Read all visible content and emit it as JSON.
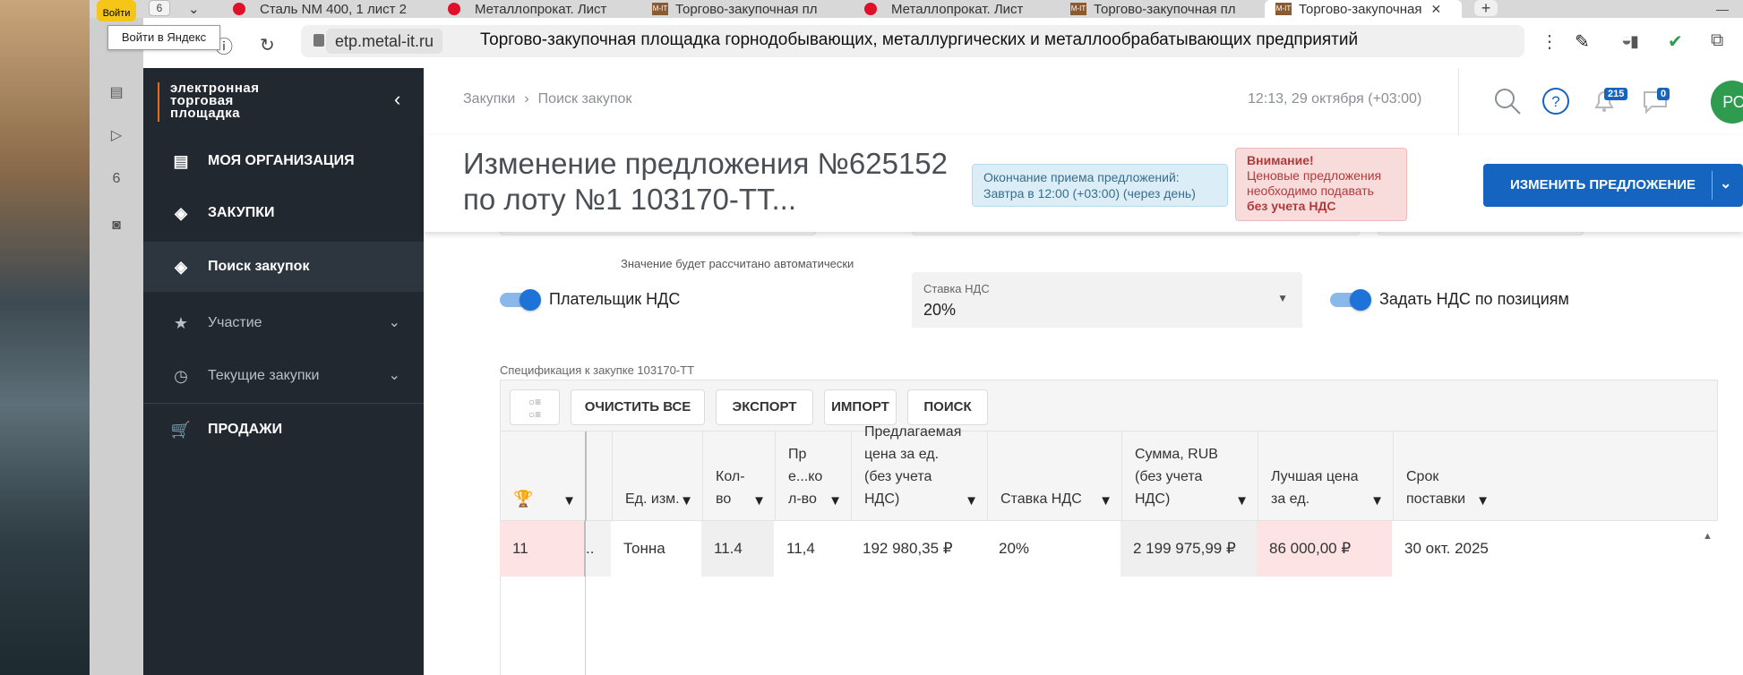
{
  "browser": {
    "tab_count": "6",
    "tabs": [
      {
        "title": "Сталь NM 400, 1 лист 2",
        "favicon": "red-dot"
      },
      {
        "title": "Металлопрокат. Лист",
        "favicon": "red-dot"
      },
      {
        "title": "Торгово-закупочная пл",
        "favicon": "mit"
      },
      {
        "title": "Металлопрокат. Лист",
        "favicon": "red-dot"
      },
      {
        "title": "Торгово-закупочная пл",
        "favicon": "mit"
      },
      {
        "title": "Торгово-закупочная",
        "favicon": "mit"
      }
    ],
    "yandex_login": "Войти",
    "tooltip": "Войти в Яндекс",
    "domain": "etp.metal-it.ru",
    "page_title": "Торгово-закупочная площадка горнодобывающих, металлургических и металлообрабатывающих предприятий",
    "favicon_text": "M-IT"
  },
  "sidebar": {
    "logo_lines": [
      "электронная",
      "торговая",
      "площадка"
    ],
    "items": [
      {
        "label": "МОЯ ОРГАНИЗАЦИЯ",
        "icon": "id-card-icon"
      },
      {
        "label": "ЗАКУПКИ",
        "icon": "cubes-icon"
      },
      {
        "label": "Поиск закупок",
        "icon": "cubes-icon"
      },
      {
        "label": "Участие",
        "icon": "star-icon"
      },
      {
        "label": "Текущие закупки",
        "icon": "clock-icon"
      },
      {
        "label": "ПРОДАЖИ",
        "icon": "cart-icon"
      }
    ]
  },
  "header": {
    "breadcrumb": [
      "Закупки",
      "Поиск закупок"
    ],
    "datetime": "12:13, 29 октября (+03:00)",
    "notifications_count": "215",
    "messages_count": "0",
    "avatar_initials": "РО"
  },
  "titlebar": {
    "heading_line1": "Изменение предложения №625152",
    "heading_line2": "по лоту №1 103170-ТТ...",
    "deadline_line1": "Окончание приема предложений:",
    "deadline_line2": "Завтра в 12:00 (+03:00) (через день)",
    "warning_title": "Внимание!",
    "warning_line1": "Ценовые предложения",
    "warning_line2": "необходимо подавать",
    "warning_bold": "без учета НДС",
    "primary_button": "ИЗМЕНИТЬ ПРЕДЛОЖЕНИЕ"
  },
  "form": {
    "auto_hint": "Значение будет рассчитано автоматически",
    "vat_payer_label": "Плательщик НДС",
    "vat_payer_on": true,
    "vat_rate_label": "Ставка НДС",
    "vat_rate_value": "20%",
    "vat_by_position_label": "Задать НДС по позициям",
    "vat_by_position_on": true
  },
  "spec": {
    "label": "Спецификация к закупке 103170-ТТ",
    "buttons": [
      "ОЧИСТИТЬ ВСЕ",
      "ЭКСПОРТ",
      "ИМПОРТ",
      "ПОИСК"
    ],
    "columns": [
      "Ед. изм.",
      "Кол-во",
      "Пре...кол-во",
      "Предлагаемая цена за ед. (без учета НДС)",
      "Ставка НДС",
      "Сумма, RUB (без учета НДС)",
      "Лучшая цена за ед.",
      "Срок поставки"
    ],
    "rows": [
      {
        "rank": "11",
        "truncated": "..",
        "unit": "Тонна",
        "qty": "11.4",
        "offered_qty": "11,4",
        "price": "192 980,35 ₽",
        "vat": "20%",
        "sum": "2 199 975,99 ₽",
        "best_price": "86 000,00 ₽",
        "delivery": "30 окт. 2025 г."
      }
    ]
  },
  "colors": {
    "primary": "#1565c0",
    "sidebar_bg": "#212830",
    "warning_bg": "#f8dcdc",
    "info_bg": "#dbeef7",
    "rank_cell_bg": "#fde3e3"
  }
}
